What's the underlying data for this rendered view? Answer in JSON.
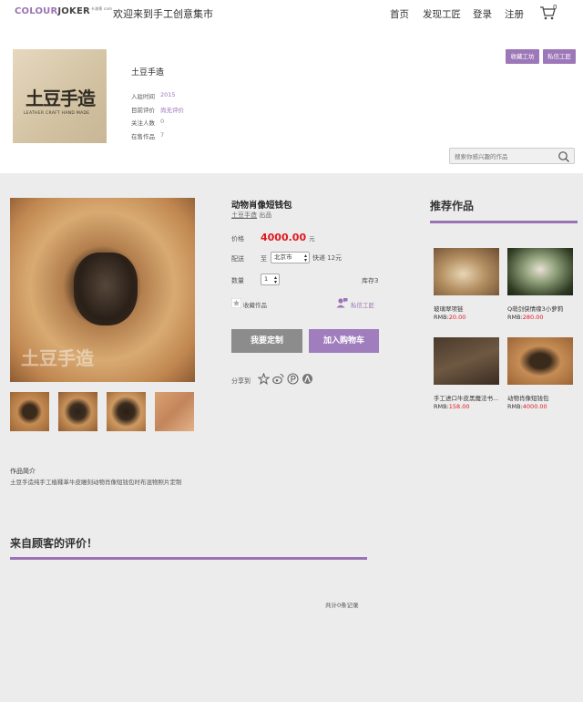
{
  "header": {
    "logo_main": "COLOUR",
    "logo_bold": "JOKER",
    "logo_sub": "卡洛蒂 com",
    "welcome": "欢迎来到手工创意集市",
    "nav": [
      "首页",
      "发现工匠",
      "登录",
      "注册"
    ],
    "cart_count": "0"
  },
  "shop": {
    "logo_text": "土豆手造",
    "logo_sub": "LEATHER CRAFT HAND MADE",
    "name": "土豆手造",
    "info": [
      {
        "label": "入驻时间",
        "value": "2015"
      },
      {
        "label": "目前评价",
        "value": "尚无评价"
      },
      {
        "label": "关注人数",
        "value": "0"
      },
      {
        "label": "在售作品",
        "value": "7"
      }
    ],
    "follow_button": "收藏工坊",
    "message_button": "私信工匠",
    "search_placeholder": "搜索你感兴趣的作品"
  },
  "product": {
    "watermark": "土豆手造",
    "title": "动物肖像短钱包",
    "maker": "土豆手造",
    "maker_suffix": "出品",
    "price_label": "价格",
    "price": "4000.00",
    "price_unit": "元",
    "ship_label": "配送",
    "ship_to": "至",
    "city": "北京市",
    "shipping": "快递 12元",
    "qty_label": "数量",
    "qty": "1",
    "stock": "库存3",
    "favorite": "收藏作品",
    "message": "私信工匠",
    "custom_button": "我要定制",
    "cart_button": "加入购物车",
    "share_label": "分享到",
    "intro_heading": "作品简介",
    "intro_text": "土豆手造纯手工植鞣革牛皮雕刻动物肖像短钱包时布混物照片定制"
  },
  "recommend": {
    "title": "推荐作品",
    "items": [
      {
        "name": "玻璃翠项链",
        "price_label": "RMB:",
        "price": "20.00"
      },
      {
        "name": "Q萌剑侠情缘3小萝莉",
        "price_label": "RMB:",
        "price": "280.00"
      },
      {
        "name": "手工进口牛皮黑魔法书...",
        "price_label": "RMB:",
        "price": "158.00"
      },
      {
        "name": "动物肖像短钱包",
        "price_label": "RMB:",
        "price": "4000.00"
      }
    ]
  },
  "reviews": {
    "title": "来自顾客的评价！",
    "count_text": "共计0条记录"
  },
  "colors": {
    "accent": "#9b73b5",
    "price_red": "#e0191f",
    "button_gray": "#8c8c8c"
  }
}
